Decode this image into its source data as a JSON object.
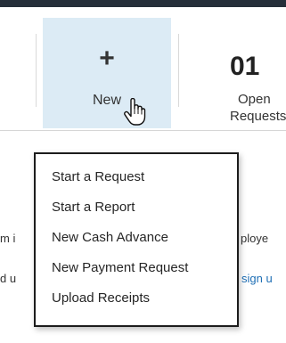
{
  "header": {
    "bar_color": "#262f3a"
  },
  "tiles": {
    "new": {
      "icon": "plus-icon",
      "symbol": "+",
      "label": "New",
      "background": "#dcebf5"
    },
    "open_requests": {
      "count": "01",
      "label_line1": "Open",
      "label_line2": "Requests"
    }
  },
  "dropdown": {
    "items": [
      "Start a Request",
      "Start a Report",
      "New Cash Advance",
      "New Payment Request",
      "Upload Receipts"
    ]
  },
  "background_rows": {
    "row1": {
      "left_fragment": "m i",
      "right_fragment": "ploye"
    },
    "row2": {
      "left_fragment": "d u",
      "right_fragment": "sign u"
    }
  },
  "cursor": {
    "icon": "hand-pointer-icon"
  }
}
